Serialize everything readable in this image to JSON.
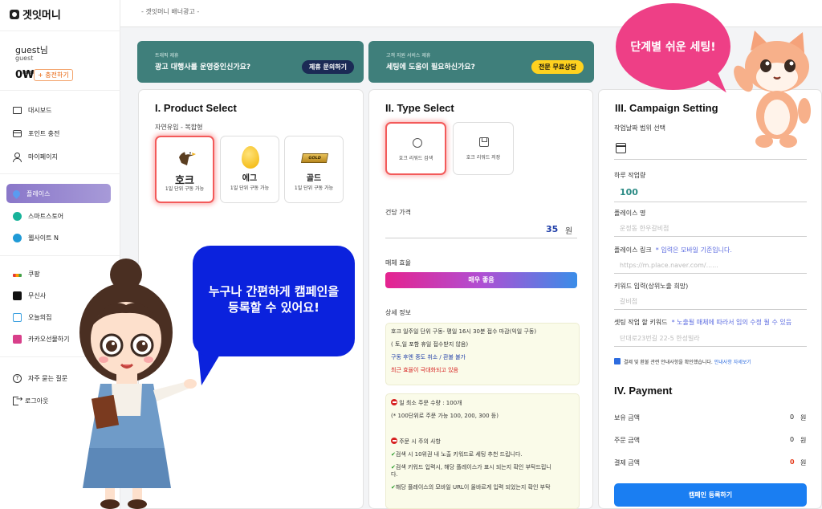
{
  "app": {
    "logo_text": "겟잇머니"
  },
  "user": {
    "name": "guest님",
    "id": "guest",
    "balance": "0₩",
    "charge_label": "+ 충전하기"
  },
  "sidebar": {
    "group1": [
      {
        "label": "대시보드",
        "icon": "monitor-icon"
      },
      {
        "label": "포인트 충전",
        "icon": "card-icon"
      },
      {
        "label": "마이페이지",
        "icon": "user-icon"
      }
    ],
    "group2": [
      {
        "label": "플레이스",
        "icon": "place-pin-icon",
        "active": true
      },
      {
        "label": "스마트스토어",
        "icon": "smartstore-icon"
      },
      {
        "label": "웹사이트 N",
        "icon": "website-icon"
      }
    ],
    "group3": [
      {
        "label": "쿠팡",
        "icon": "coupang-icon"
      },
      {
        "label": "무신사",
        "icon": "musinsa-icon"
      },
      {
        "label": "오늘의집",
        "icon": "ohouse-icon"
      },
      {
        "label": "카카오선물하기",
        "icon": "kakao-gift-icon"
      }
    ],
    "group4": [
      {
        "label": "자주 묻는 질문",
        "icon": "question-icon"
      },
      {
        "label": "로그아웃",
        "icon": "logout-icon"
      }
    ]
  },
  "topbar": {
    "ad_text": "- 겟잇머니 배너광고 -"
  },
  "banners": [
    {
      "small": "트래픽 제휴",
      "big": "광고 대행사를 운영중인신가요?",
      "button": "제휴 문의하기"
    },
    {
      "small": "고객 지원 서비스 제휴",
      "big": "세팅에 도움이 필요하신가요?",
      "button": "전문 무료상담"
    }
  ],
  "product_select": {
    "title": "I. Product Select",
    "subtitle": "자연유입 - 복합형",
    "items": [
      {
        "name": "호크",
        "desc": "1일 단위 구동 가능",
        "selected": true,
        "icon": "eagle-icon"
      },
      {
        "name": "에그",
        "desc": "1일 단위 구동 가능",
        "selected": false,
        "icon": "egg-icon"
      },
      {
        "name": "골드",
        "desc": "1일 단위 구동 가능",
        "selected": false,
        "icon": "gold-bar-icon",
        "icon_text": "GOLD"
      }
    ]
  },
  "type_select": {
    "title": "II. Type Select",
    "items": [
      {
        "label": "호크 리워드 검색",
        "selected": true,
        "icon": "aperture-icon"
      },
      {
        "label": "호크 리워드 저장",
        "selected": false,
        "icon": "floppy-icon"
      }
    ],
    "price_label": "건당 가격",
    "price_value": "35",
    "price_unit": "원",
    "efficiency_label": "매체 효율",
    "efficiency_value": "매우 좋음",
    "detail_label": "상세 정보",
    "detail_lines": [
      "호크 일주일 단위 구동- 평일 16시 30분 접수 마감(익일 구동)",
      "( 토,일 포함 휴일 접수받지 않음)",
      "구동 후엔 중도 취소 / 환불 불가",
      "최근 효율이 극대화되고 있음"
    ],
    "notice": {
      "min_order": "일 최소 주문 수량 : 100개",
      "min_order_note": "(* 100단위로 주문 가능 100, 200, 300 등)",
      "caution_title": "주문 시 주의 사항",
      "cautions": [
        "검색 시 10위권 내 노출 키워드로 세팅 추천 드립니다.",
        "검색 키워드 입력시, 해당 플레이스가 표시 되는지 확인 부탁드립니",
        "다.",
        "해당 플레이스의 모바일 URL이 올바르게 입력 되었는지 확인 부탁"
      ]
    }
  },
  "campaign": {
    "title": "III. Campaign Setting",
    "date_label": "작업날짜 범위 선택",
    "daily_label": "하루 작업량",
    "daily_value": "100",
    "place_name_label": "플레이스 명",
    "place_name_placeholder": "운정동 한우갈비점",
    "place_link_label": "플레이스 링크",
    "place_link_note": "* 입력은 모바일 기준입니다.",
    "place_link_placeholder": "https://m.place.naver.com/......",
    "keyword_label": "키워드 입력(상위노출 희망)",
    "keyword_placeholder": "갈비점",
    "setting_keyword_label": "셋팅 작업 할 키워드",
    "setting_keyword_note": "* 노출될 매체에 따라서 임의 수정 될 수 있음",
    "setting_keyword_placeholder": "단대로23번길 22-5 한성빌라",
    "consent_text": "결제 및 환불 관련 안내사항을 확인했습니다.",
    "consent_link": "안내사항 자세보기"
  },
  "payment": {
    "title": "IV. Payment",
    "rows": [
      {
        "label": "보유 금액",
        "value": "0",
        "unit": "원",
        "color": "#222222"
      },
      {
        "label": "주문 금액",
        "value": "0",
        "unit": "원",
        "color": "#222222"
      },
      {
        "label": "결제 금액",
        "value": "0",
        "unit": "원",
        "color": "#e53b1b"
      }
    ],
    "register_label": "캠페인 등록하기"
  },
  "overlays": {
    "blue_bubble_lines": [
      "누구나 간편하게 캠페인을",
      "등록할 수 있어요!"
    ],
    "pink_bubble": "단계별 쉬운 세팅!"
  },
  "colors": {
    "banner": "#3f7f7b",
    "accent_blue": "#1a7ef2",
    "pink": "#ee3f86",
    "blue_bubble": "#0b22dd"
  }
}
